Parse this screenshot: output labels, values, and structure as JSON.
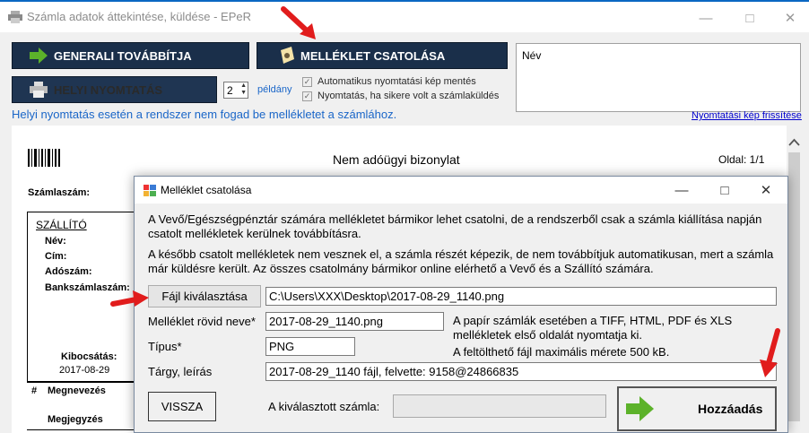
{
  "window": {
    "title": "Számla adatok áttekintése, küldése - EPeR"
  },
  "toolbar": {
    "generali_label": "GENERALI TOVÁBBÍTJA",
    "attach_label": "MELLÉKLET CSATOLÁSA",
    "print_label": "HELYI NYOMTATÁS",
    "copies_value": "2",
    "copies_unit": "példány",
    "auto_save_label": "Automatikus nyomtatási kép mentés",
    "print_on_success_label": "Nyomtatás, ha sikere volt a számlaküldés",
    "name_box_label": "Név"
  },
  "info": {
    "local_print_note": "Helyi nyomtatás esetén a rendszer nem fogad be mellékletet a számlához.",
    "refresh_link": "Nyomtatási kép frissítése"
  },
  "document": {
    "heading": "Nem adóügyi bizonylat",
    "page": "Oldal: 1/1",
    "invoice_no_label": "Számlaszám:",
    "supplier_title": "SZÁLLÍTÓ",
    "name_label": "Név:",
    "address_label": "Cím:",
    "tax_label": "Adószám:",
    "bank_label": "Bankszámlaszám:",
    "issued_label": "Kibocsátás:",
    "issued_date": "2017-08-29",
    "hash": "#",
    "item_label": "Megnevezés",
    "note_label": "Megjegyzés"
  },
  "dialog": {
    "title": "Melléklet csatolása",
    "para1": "A Vevő/Egészségpénztár számára mellékletet bármikor lehet csatolni, de a rendszerből csak a számla kiállítása napján csatolt mellékletek kerülnek továbbításra.",
    "para2": "A később csatolt mellékletek nem vesznek el, a számla részét képezik, de nem továbbítjuk automatikusan, mert a számla már küldésre került. Az összes csatolmány bármikor online elérhető a Vevő és a Szállító számára.",
    "choose_file_label": "Fájl kiválasztása",
    "file_path": "C:\\Users\\XXX\\Desktop\\2017-08-29_1140.png",
    "short_name_label": "Melléklet rövid neve*",
    "short_name_value": "2017-08-29_1140.png",
    "type_label": "Típus*",
    "type_value": "PNG",
    "subject_label": "Tárgy, leírás",
    "subject_value": "2017-08-29_1140 fájl, felvette: 9158@24866835",
    "format_note": "A papír számlák esetében a TIFF, HTML, PDF és XLS mellékletek első oldalát nyomtatja ki.",
    "size_note": "A feltölthető fájl maximális mérete 500 kB.",
    "back_label": "VISSZA",
    "selected_invoice_label": "A kiválasztott számla:",
    "selected_invoice_value": "",
    "add_label": "Hozzáadás"
  },
  "colors": {
    "nav_button": "#1a2f4a",
    "link": "#1a66c8",
    "accent_arrow": "#e11c1c",
    "add_icon": "#5cb22a"
  }
}
